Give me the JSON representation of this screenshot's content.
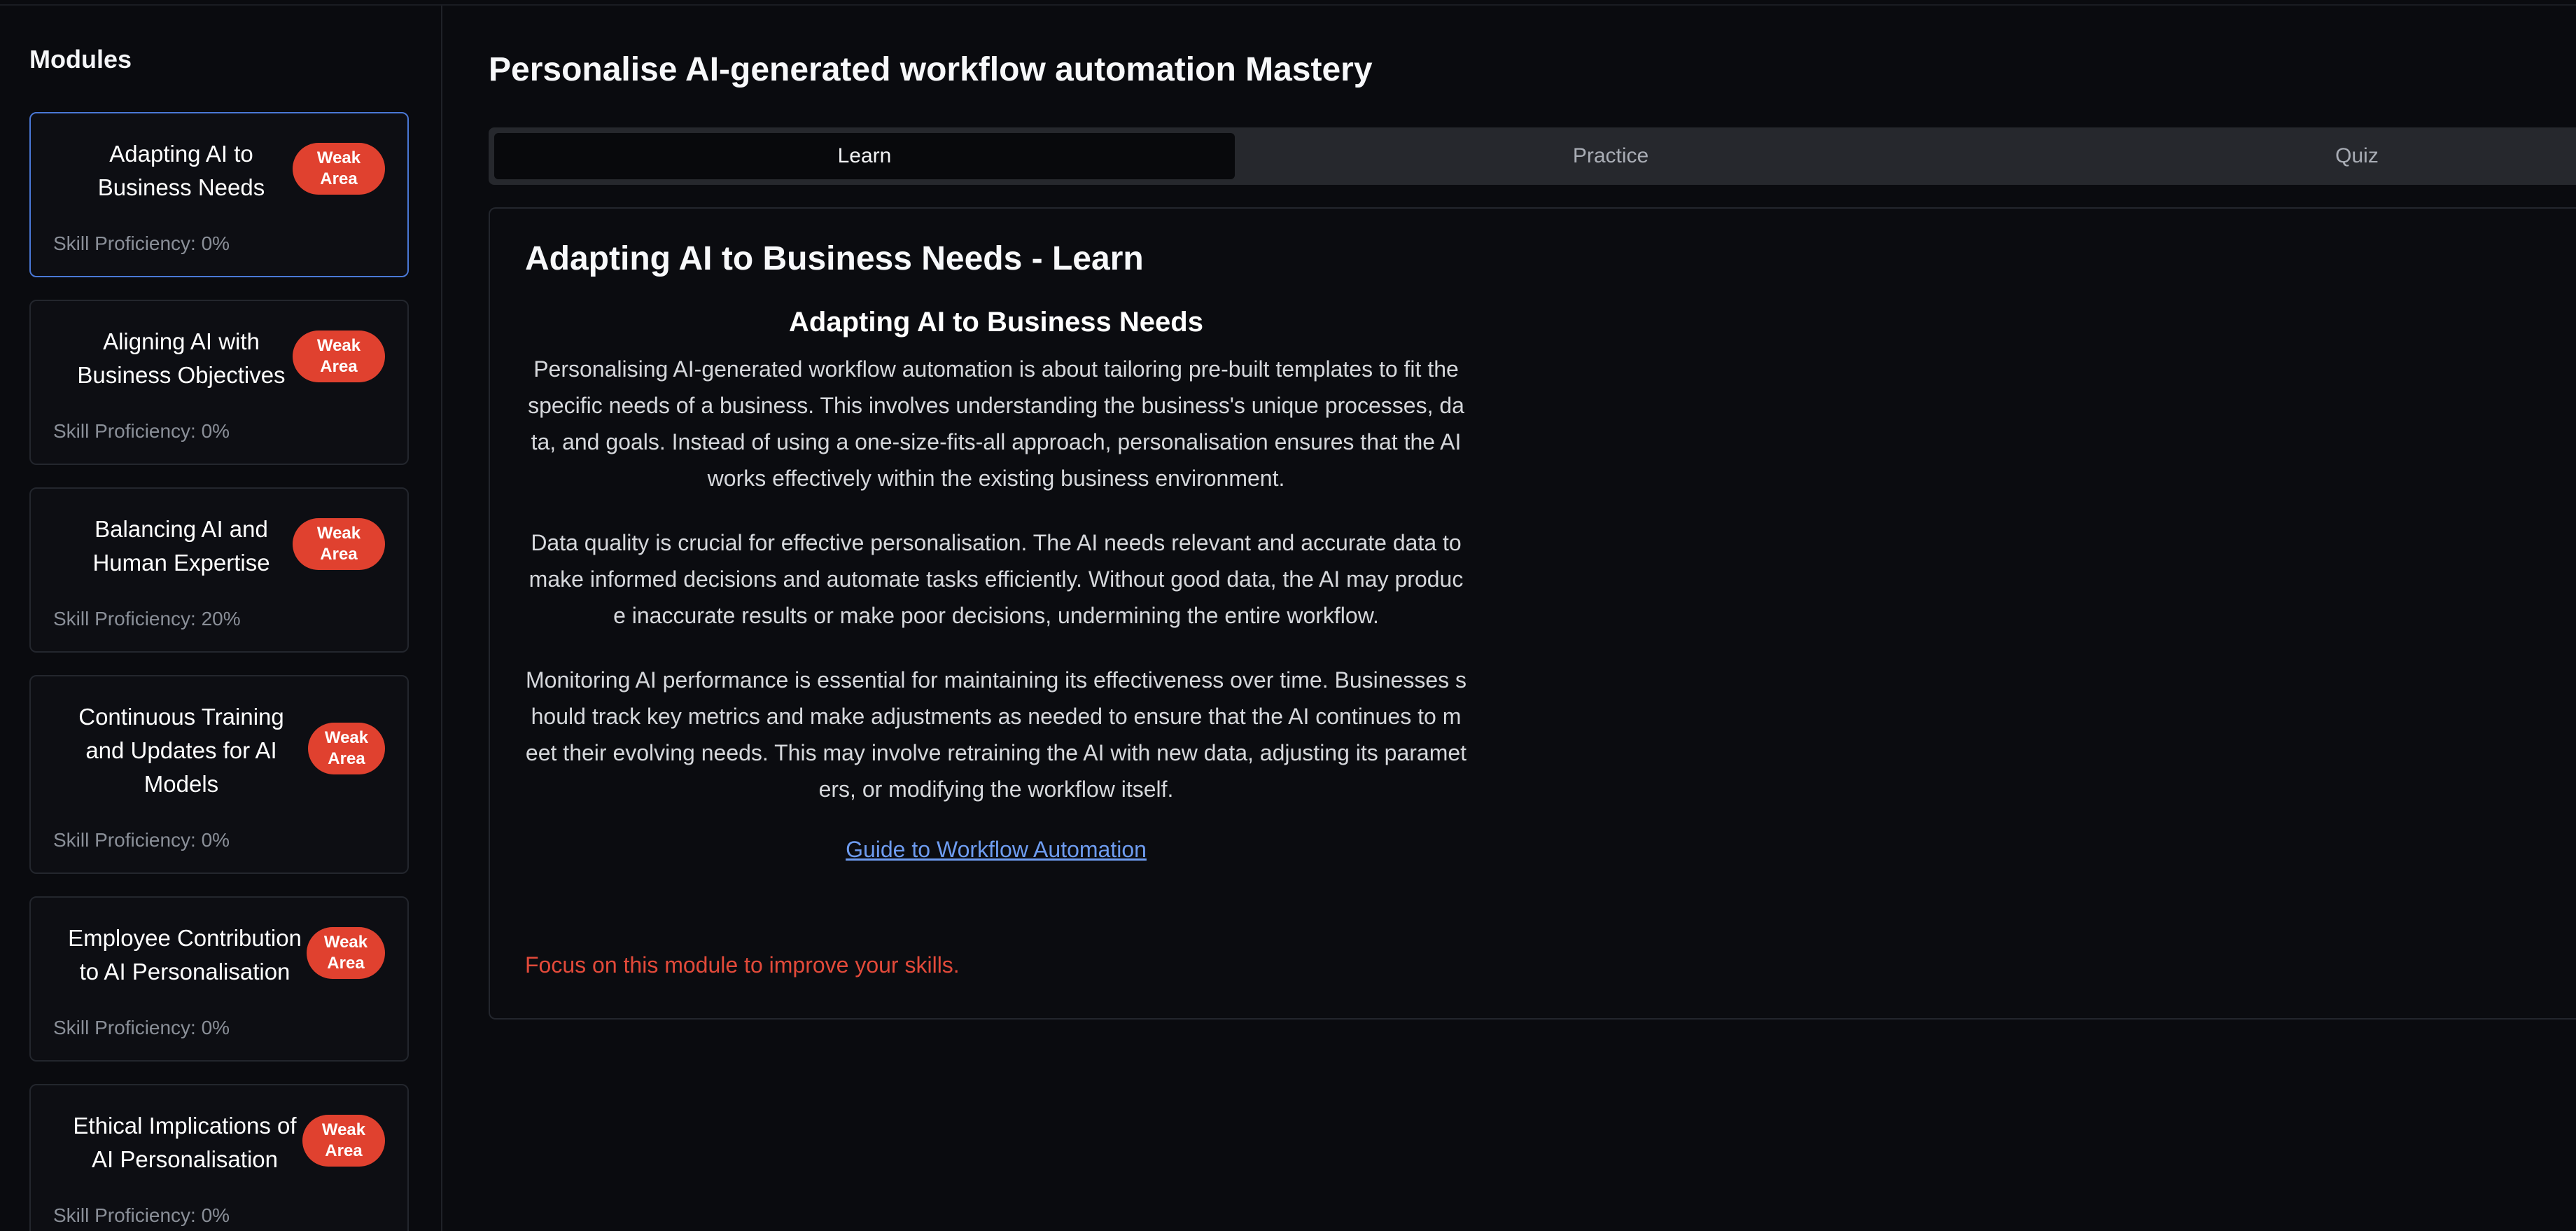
{
  "sidebar": {
    "title": "Modules",
    "modules": [
      {
        "title_lines": [
          "Adapting AI to",
          "Business Needs"
        ],
        "badge": [
          "Weak",
          "Area"
        ],
        "proficiency": "Skill Proficiency: 0%"
      },
      {
        "title_lines": [
          "Aligning AI with",
          "Business Objectives"
        ],
        "badge": [
          "Weak",
          "Area"
        ],
        "proficiency": "Skill Proficiency: 0%"
      },
      {
        "title_lines": [
          "Balancing AI and",
          "Human Expertise"
        ],
        "badge": [
          "Weak",
          "Area"
        ],
        "proficiency": "Skill Proficiency: 20%"
      },
      {
        "title_lines": [
          "Continuous Training",
          "and Updates for AI",
          "Models"
        ],
        "badge": [
          "Weak",
          "Area"
        ],
        "proficiency": "Skill Proficiency: 0%"
      },
      {
        "title_lines": [
          "Employee Contribution",
          "to AI Personalisation"
        ],
        "badge": [
          "Weak",
          "Area"
        ],
        "proficiency": "Skill Proficiency: 0%"
      },
      {
        "title_lines": [
          "Ethical Implications of",
          "AI Personalisation"
        ],
        "badge": [
          "Weak",
          "Area"
        ],
        "proficiency": "Skill Proficiency: 0%"
      }
    ]
  },
  "header": {
    "title": "Personalise AI-generated workflow automation Mastery"
  },
  "tabs": [
    {
      "label": "Learn"
    },
    {
      "label": "Practice"
    },
    {
      "label": "Quiz"
    }
  ],
  "content": {
    "heading": "Adapting AI to Business Needs - Learn",
    "article_title": "Adapting AI to Business Needs",
    "paragraphs": [
      "Personalising AI-generated workflow automation is about tailoring pre-built templates to fit the specific needs of a business. This involves understanding the business's unique processes, data, and goals. Instead of using a one-size-fits-all approach, personalisation ensures that the AI works effectively within the existing business environment.",
      "Data quality is crucial for effective personalisation. The AI needs relevant and accurate data to make informed decisions and automate tasks efficiently. Without good data, the AI may produce inaccurate results or make poor decisions, undermining the entire workflow.",
      "Monitoring AI performance is essential for maintaining its effectiveness over time. Businesses should track key metrics and make adjustments as needed to ensure that the AI continues to meet their evolving needs. This may involve retraining the AI with new data, adjusting its parameters, or modifying the workflow itself."
    ],
    "link_text": "Guide to Workflow Automation",
    "focus_note": "Focus on this module to improve your skills."
  },
  "colors": {
    "accent_link": "#6e9cf0",
    "badge_red": "#e0412f",
    "active_border": "#4a78d6",
    "warning_text": "#e34a3a"
  }
}
